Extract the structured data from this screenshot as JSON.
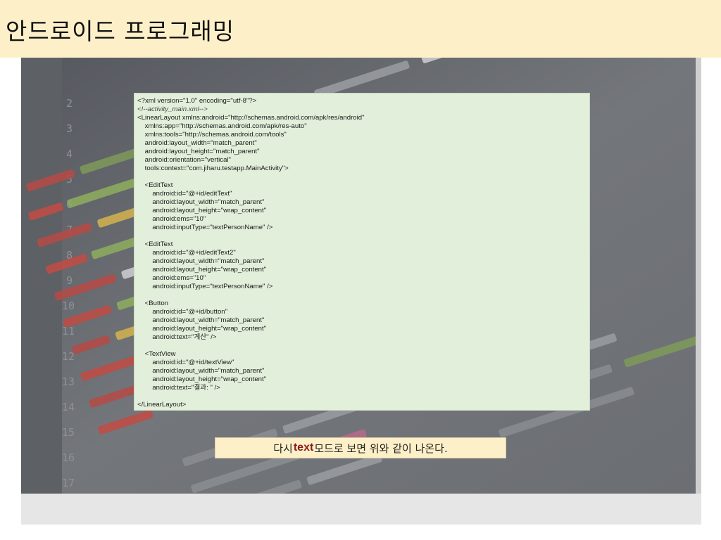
{
  "slide": {
    "title": "안드로이드 프로그래밍"
  },
  "code": {
    "lines": [
      {
        "text": "<?xml version=\"1.0\" encoding=\"utf-8\"?>",
        "style": "normal"
      },
      {
        "text": "<!--activity_main.xml-->",
        "style": "comment"
      },
      {
        "text": "<LinearLayout xmlns:android=\"http://schemas.android.com/apk/res/android\"",
        "style": "normal"
      },
      {
        "text": "    xmlns:app=\"http://schemas.android.com/apk/res-auto\"",
        "style": "normal"
      },
      {
        "text": "    xmlns:tools=\"http://schemas.android.com/tools\"",
        "style": "normal"
      },
      {
        "text": "    android:layout_width=\"match_parent\"",
        "style": "normal"
      },
      {
        "text": "    android:layout_height=\"match_parent\"",
        "style": "normal"
      },
      {
        "text": "    android:orientation=\"vertical\"",
        "style": "normal"
      },
      {
        "text": "    tools:context=\"com.jiharu.testapp.MainActivity\">",
        "style": "normal"
      },
      {
        "text": "",
        "style": "normal"
      },
      {
        "text": "    <EditText",
        "style": "normal"
      },
      {
        "text": "        android:id=\"@+id/editText\"",
        "style": "normal"
      },
      {
        "text": "        android:layout_width=\"match_parent\"",
        "style": "normal"
      },
      {
        "text": "        android:layout_height=\"wrap_content\"",
        "style": "normal"
      },
      {
        "text": "        android:ems=\"10\"",
        "style": "normal"
      },
      {
        "text": "        android:inputType=\"textPersonName\" />",
        "style": "normal"
      },
      {
        "text": "",
        "style": "normal"
      },
      {
        "text": "    <EditText",
        "style": "normal"
      },
      {
        "text": "        android:id=\"@+id/editText2\"",
        "style": "normal"
      },
      {
        "text": "        android:layout_width=\"match_parent\"",
        "style": "normal"
      },
      {
        "text": "        android:layout_height=\"wrap_content\"",
        "style": "normal"
      },
      {
        "text": "        android:ems=\"10\"",
        "style": "normal"
      },
      {
        "text": "        android:inputType=\"textPersonName\" />",
        "style": "normal"
      },
      {
        "text": "",
        "style": "normal"
      },
      {
        "text": "    <Button",
        "style": "normal"
      },
      {
        "text": "        android:id=\"@+id/button\"",
        "style": "normal"
      },
      {
        "text": "        android:layout_width=\"match_parent\"",
        "style": "normal"
      },
      {
        "text": "        android:layout_height=\"wrap_content\"",
        "style": "normal"
      },
      {
        "text": "        android:text=\"계산\" />",
        "style": "normal"
      },
      {
        "text": "",
        "style": "normal"
      },
      {
        "text": "    <TextView",
        "style": "normal"
      },
      {
        "text": "        android:id=\"@+id/textView\"",
        "style": "normal"
      },
      {
        "text": "        android:layout_width=\"match_parent\"",
        "style": "normal"
      },
      {
        "text": "        android:layout_height=\"wrap_content\"",
        "style": "normal"
      },
      {
        "text": "        android:text=\"결과: \" />",
        "style": "normal"
      },
      {
        "text": "",
        "style": "normal"
      },
      {
        "text": "</LinearLayout>",
        "style": "normal"
      }
    ]
  },
  "caption": {
    "before": "다시 ",
    "keyword": "text",
    "after": "모드로 보면 위와 같이 나온다."
  },
  "colors": {
    "title_bg": "#fdf0c8",
    "code_bg": "#e2efda",
    "caption_keyword": "#8b1a1a"
  }
}
